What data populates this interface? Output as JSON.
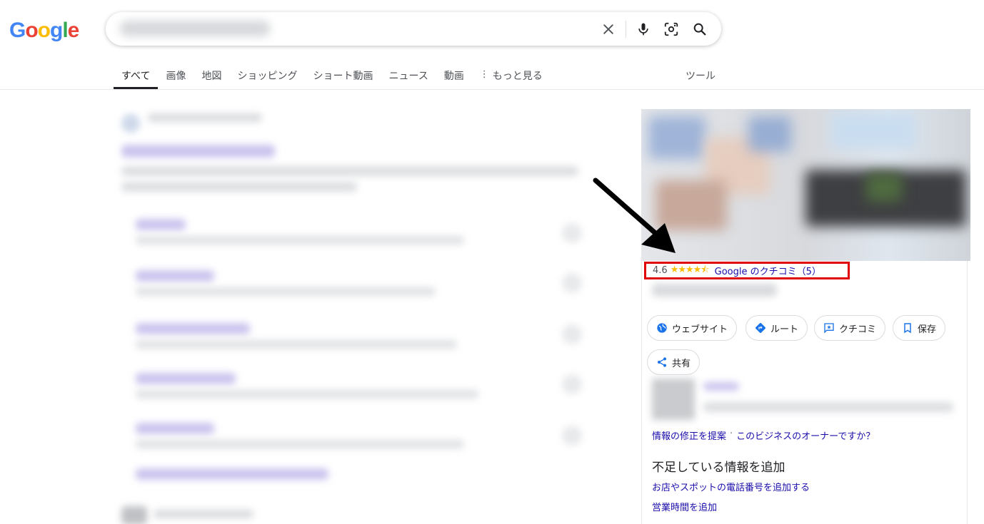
{
  "logo": {
    "letters": [
      "G",
      "o",
      "o",
      "g",
      "l",
      "e"
    ],
    "colors": [
      "#4285F4",
      "#EA4335",
      "#FBBC05",
      "#4285F4",
      "#34A853",
      "#EA4335"
    ]
  },
  "search": {
    "query": "",
    "icons": [
      "close-icon",
      "microphone-icon",
      "lens-icon",
      "search-icon"
    ]
  },
  "tabs": [
    {
      "label": "すべて",
      "active": true
    },
    {
      "label": "画像"
    },
    {
      "label": "地図"
    },
    {
      "label": "ショッピング"
    },
    {
      "label": "ショート動画"
    },
    {
      "label": "ニュース"
    },
    {
      "label": "動画"
    },
    {
      "label": "もっと見る"
    }
  ],
  "tools_label": "ツール",
  "knowledge_panel": {
    "rating": "4.6",
    "stars": "★★★★⯪",
    "review_link": "Google のクチコミ（5）",
    "highlight_color": "#e00000",
    "actions": {
      "website": "ウェブサイト",
      "route": "ルート",
      "reviews": "クチコミ",
      "save": "保存",
      "share": "共有"
    },
    "suggest_edit": "情報の修正を提案",
    "separator": "·",
    "owner_link": "このビジネスのオーナーですか？",
    "missing_info_title": "不足している情報を追加",
    "add_phone": "お店やスポットの電話番号を追加する",
    "add_hours": "営業時間を追加"
  },
  "colors": {
    "link": "#1a0dab",
    "accent_blue": "#1a73e8",
    "star": "#fbbc04"
  }
}
